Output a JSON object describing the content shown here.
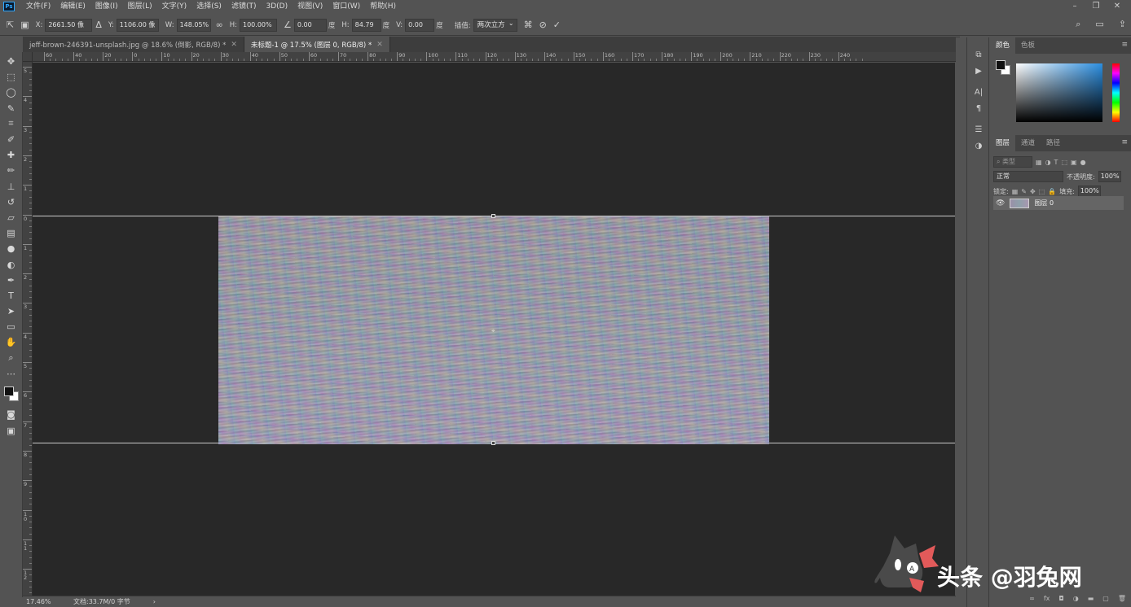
{
  "app": {
    "logo": "Ps"
  },
  "menu": [
    "文件(F)",
    "编辑(E)",
    "图像(I)",
    "图层(L)",
    "文字(Y)",
    "选择(S)",
    "滤镜(T)",
    "3D(D)",
    "视图(V)",
    "窗口(W)",
    "帮助(H)"
  ],
  "options": {
    "x_label": "X:",
    "x_value": "2661.50 像",
    "y_label": "Y:",
    "y_value": "1106.00 像",
    "w_label": "W:",
    "w_value": "148.05%",
    "h_label": "H:",
    "h_value": "100.00%",
    "angle_value": "0.00",
    "angle_unit": "度",
    "hskew_label": "H:",
    "hskew_value": "84.79",
    "hskew_unit": "度",
    "vskew_label": "V:",
    "vskew_value": "0.00",
    "vskew_unit": "度",
    "interp_label": "插值:",
    "interp_value": "两次立方"
  },
  "tabs": [
    {
      "label": "jeff-brown-246391-unsplash.jpg @ 18.6% (倒影, RGB/8) *",
      "active": false
    },
    {
      "label": "未标题-1 @ 17.5% (图层 0, RGB/8) *",
      "active": true
    }
  ],
  "ruler_top": [
    "60",
    "40",
    "20",
    "0",
    "10",
    "20",
    "30",
    "40",
    "50",
    "60",
    "70",
    "80",
    "90",
    "100",
    "110",
    "120",
    "130",
    "140",
    "150",
    "160",
    "170",
    "180",
    "190",
    "200",
    "210",
    "220",
    "230",
    "240"
  ],
  "ruler_left": [
    "5",
    "4",
    "3",
    "2",
    "1",
    "0",
    "1",
    "2",
    "3",
    "4",
    "5",
    "6",
    "7",
    "8",
    "9",
    "10",
    "11",
    "12"
  ],
  "panels": {
    "color_tabs": [
      "颜色",
      "色板"
    ],
    "layer_tabs": [
      "图层",
      "通道",
      "路径"
    ],
    "kind_placeholder": "类型",
    "blend_mode": "正常",
    "opacity_label": "不透明度:",
    "opacity_value": "100%",
    "lock_label": "锁定:",
    "fill_label": "填充:",
    "fill_value": "100%",
    "layer_name": "图层 0"
  },
  "status": {
    "zoom": "17.46%",
    "doc": "文档:33.7M/0 字节"
  },
  "watermark": {
    "text": "头条 @羽兔网"
  },
  "colors": {
    "ui_bg": "#535353",
    "canvas_bg": "#282828",
    "accent": "#31a8ff"
  }
}
